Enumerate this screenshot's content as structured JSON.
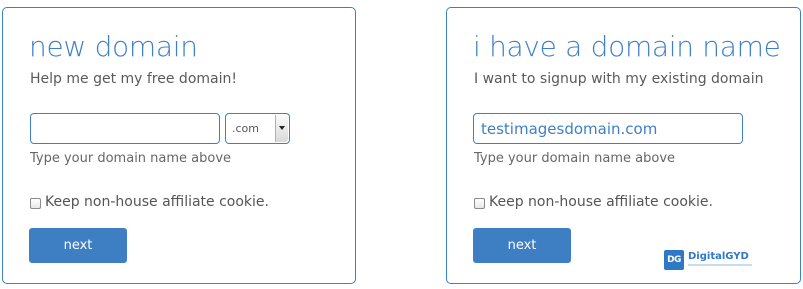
{
  "new_domain_panel": {
    "title": "new domain",
    "subtitle": "Help me get my free domain!",
    "domain_input_value": "",
    "tld_selected": ".com",
    "hint": "Type your domain name above",
    "checkbox_label": "Keep non-house affiliate cookie.",
    "checkbox_checked": false,
    "next_label": "next"
  },
  "existing_domain_panel": {
    "title": "i have a domain name",
    "subtitle": "I want to signup with my existing domain",
    "domain_input_value": "testimagesdomain.com",
    "hint": "Type your domain name above",
    "checkbox_label": "Keep non-house affiliate cookie.",
    "checkbox_checked": false,
    "next_label": "next"
  },
  "watermark": {
    "logo_text": "DG",
    "name": "DigitalGYD"
  },
  "colors": {
    "accent": "#3e80c8",
    "button": "#3e7fc4",
    "text_gray": "#5a5a5a"
  }
}
